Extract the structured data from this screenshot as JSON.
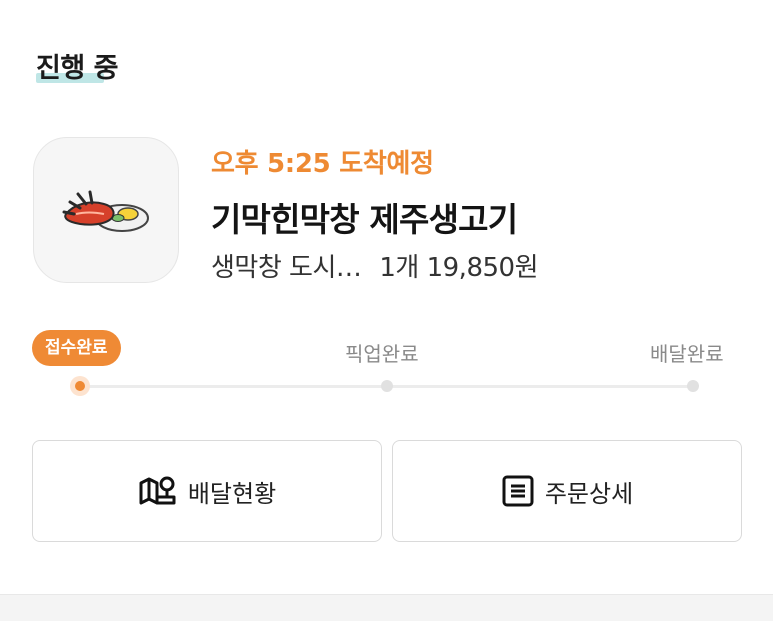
{
  "section": {
    "title": "진행 중"
  },
  "order": {
    "eta": "오후 5:25 도착예정",
    "store_name": "기막힌막창 제주생고기",
    "item_summary": "생막창 도시…",
    "quantity_price": "1개 19,850원"
  },
  "progress": {
    "steps": [
      {
        "label": "접수완료",
        "active": true
      },
      {
        "label": "픽업완료",
        "active": false
      },
      {
        "label": "배달완료",
        "active": false
      }
    ],
    "current_step": 1
  },
  "actions": {
    "delivery_status_label": "배달현황",
    "order_detail_label": "주문상세"
  },
  "colors": {
    "accent": "#ef8a35",
    "highlight": "#bfe6e6"
  },
  "icons": {
    "store_logo": "grilled-intestine-logo",
    "delivery_status": "map-pin-icon",
    "order_detail": "document-lines-icon"
  }
}
